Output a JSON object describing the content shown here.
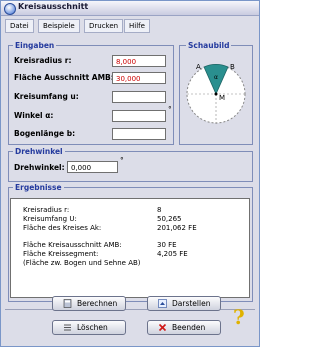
{
  "window": {
    "title": "Kreisausschnitt"
  },
  "menu": [
    "Datei",
    "Beispiele",
    "Drucken",
    "Hilfe"
  ],
  "eingaben": {
    "legend": "Eingaben",
    "fields": [
      {
        "label": "Kreisradius r:",
        "value": "8,000"
      },
      {
        "label": "Fläche Ausschnitt AMB:",
        "value": "30,000"
      },
      {
        "label": "Kreisumfang u:",
        "value": ""
      },
      {
        "label": "Winkel   α:",
        "value": "",
        "unit": "°"
      },
      {
        "label": "Bogenlänge b:",
        "value": ""
      }
    ]
  },
  "schaubild": {
    "legend": "Schaubild",
    "labels": {
      "a": "A",
      "b": "B",
      "m": "M",
      "alpha": "α"
    }
  },
  "drehwinkel": {
    "legend": "Drehwinkel",
    "label": "Drehwinkel:",
    "value": "0,000",
    "unit": "°"
  },
  "ergebnisse": {
    "legend": "Ergebnisse",
    "rows": [
      {
        "label": "Kreisradius  r:",
        "value": "8"
      },
      {
        "label": "Kreisumfang U:",
        "value": "50,265"
      },
      {
        "label": "Fläche des Kreises Ak:",
        "value": "201,062 FE"
      },
      {
        "label": "Fläche Kreisausschnitt AMB:",
        "value": "30 FE"
      },
      {
        "label": "Fläche Kreissegment:",
        "value": "4,205 FE"
      },
      {
        "label": "(Fläche zw. Bogen und Sehne AB)",
        "value": ""
      }
    ]
  },
  "buttons": {
    "berechnen": "Berechnen",
    "darstellen": "Darstellen",
    "loeschen": "Löschen",
    "beenden": "Beenden"
  },
  "help": "?",
  "colors": {
    "accent": "#243a9e",
    "input_value": "#cc0000",
    "sector": "#2a8f8f"
  }
}
